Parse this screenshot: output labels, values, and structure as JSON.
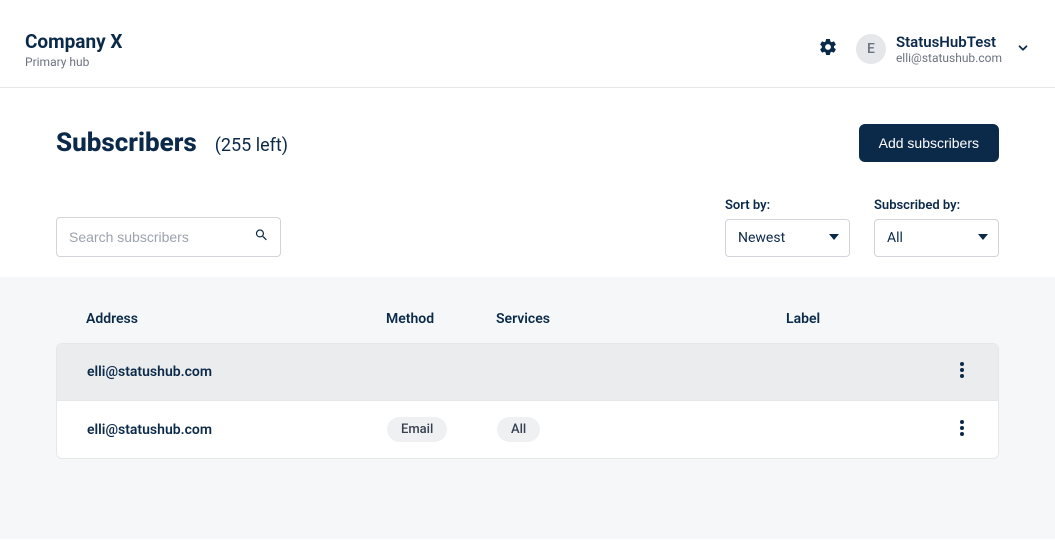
{
  "header": {
    "company": "Company X",
    "hub_label": "Primary hub",
    "user": {
      "initial": "E",
      "name": "StatusHubTest",
      "email": "elli@statushub.com"
    }
  },
  "page": {
    "title": "Subscribers",
    "count_text": "(255 left)",
    "add_button": "Add subscribers"
  },
  "search": {
    "placeholder": "Search subscribers"
  },
  "filters": {
    "sort": {
      "label": "Sort by:",
      "value": "Newest"
    },
    "subscribed": {
      "label": "Subscribed by:",
      "value": "All"
    }
  },
  "table": {
    "headers": {
      "address": "Address",
      "method": "Method",
      "services": "Services",
      "label": "Label"
    },
    "rows": [
      {
        "address": "elli@statushub.com",
        "method": "",
        "services": "",
        "label": "",
        "highlight": true
      },
      {
        "address": "elli@statushub.com",
        "method": "Email",
        "services": "All",
        "label": "",
        "highlight": false
      }
    ]
  }
}
